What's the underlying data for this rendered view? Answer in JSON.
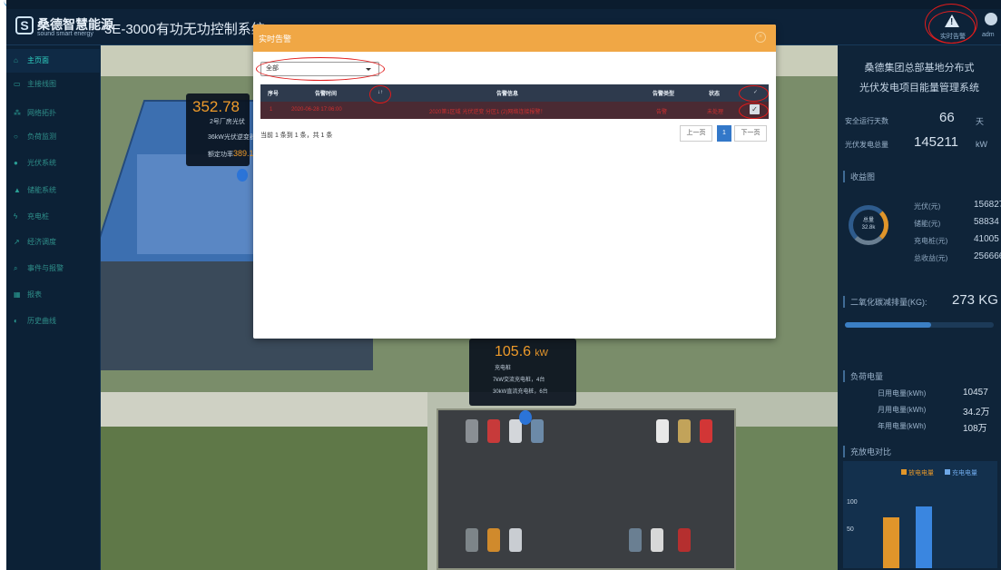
{
  "header": {
    "brand_cn": "桑德智慧能源",
    "brand_en": "sound smart energy",
    "app_title": "3E-3000有功无功控制系统",
    "alarm_label": "实时告警",
    "user_label": "adm"
  },
  "sidebar": {
    "items": [
      {
        "label": "主页面",
        "icon": "home-icon"
      },
      {
        "label": "主接线图",
        "icon": "diagram-icon"
      },
      {
        "label": "网络拓扑",
        "icon": "network-icon"
      },
      {
        "label": "负荷监测",
        "icon": "monitor-icon"
      },
      {
        "label": "光伏系统",
        "icon": "solar-icon"
      },
      {
        "label": "储能系统",
        "icon": "battery-icon"
      },
      {
        "label": "充电桩",
        "icon": "charger-icon"
      },
      {
        "label": "经济调度",
        "icon": "chart-icon"
      },
      {
        "label": "事件与报警",
        "icon": "search-icon"
      },
      {
        "label": "报表",
        "icon": "table-icon"
      },
      {
        "label": "历史曲线",
        "icon": "history-icon"
      }
    ]
  },
  "scene": {
    "pv": {
      "power": "352.78",
      "name": "2号厂房光伏",
      "desc": "36kW光伏逆变器",
      "rated_label": "额定功率",
      "rated_value": "389.1"
    },
    "charger": {
      "power": "105.6",
      "unit": "kW",
      "name": "充电桩",
      "line1": "7kW交流充电桩，4台",
      "line2": "30kW直流充电桩，6台"
    }
  },
  "right_panel": {
    "title1": "桑德集团总部基地分布式",
    "title2": "光伏发电项目能量管理系统",
    "safe_days_label": "安全运行天数",
    "safe_days_value": "66",
    "safe_days_unit": "天",
    "pv_total_label": "光伏发电总量",
    "pv_total_value": "145211",
    "pv_total_unit": "kW",
    "revenue_title": "收益图",
    "donut_label": "总量",
    "donut_value": "32.8k",
    "revenue": [
      {
        "label": "光伏(元)",
        "value": "156827"
      },
      {
        "label": "储能(元)",
        "value": "58834"
      },
      {
        "label": "充电桩(元)",
        "value": "41005"
      },
      {
        "label": "总收益(元)",
        "value": "256666"
      }
    ],
    "co2_label": "二氧化碳减排量(KG):",
    "co2_value": "273 KG",
    "co2_fraction": 0.58,
    "load_title": "负荷电量",
    "loads": [
      {
        "label": "日用电量(kWh)",
        "value": "10457"
      },
      {
        "label": "月用电量(kWh)",
        "value": "34.2万"
      },
      {
        "label": "年用电量(kWh)",
        "value": "108万"
      }
    ],
    "compare_title": "充放电对比",
    "compare_legend": [
      "放电电量",
      "充电电量"
    ],
    "compare_ticks": [
      "100",
      "50"
    ],
    "colors": {
      "discharge": "#e0952a",
      "charge": "#3a86e0"
    }
  },
  "modal": {
    "title": "实时告警",
    "filter_value": "全部",
    "columns": [
      "序号",
      "告警时间",
      "告警信息",
      "告警类型",
      "状态"
    ],
    "rows": [
      {
        "index": "1",
        "time": "2020-06-28 17:06:00",
        "info": "2020第1区域 光伏逆变 分区1 (2)网络连接报警！",
        "type": "告警",
        "status": "未处理"
      }
    ],
    "summary": "当前 1 条到 1 条，共 1 条",
    "pager": {
      "prev": "上一页",
      "current": "1",
      "next": "下一页"
    }
  }
}
